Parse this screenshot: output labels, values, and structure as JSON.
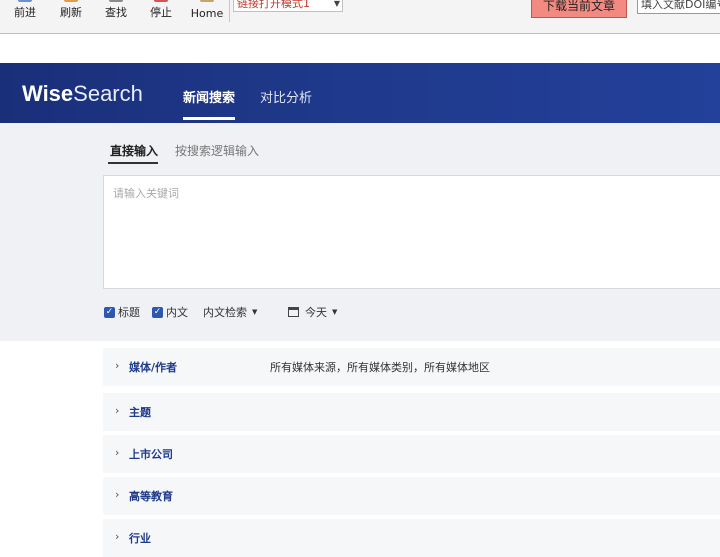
{
  "browser_toolbar": {
    "buttons": [
      "前进",
      "刷新",
      "查找",
      "停止",
      "Home"
    ],
    "mode_select": "链接打开模式1",
    "download_button": "下载当前文章",
    "doi_input_value": "填入文献DOI编号"
  },
  "header": {
    "logo_bold": "Wise",
    "logo_light": "Search",
    "nav": [
      "新闻搜索",
      "对比分析"
    ]
  },
  "search": {
    "tabs": [
      "直接输入",
      "按搜索逻辑输入"
    ],
    "placeholder": "请输入关键词",
    "options": {
      "title_label": "标题",
      "content_label": "内文",
      "scope_label": "内文检索",
      "date_label": "今天"
    }
  },
  "filters": [
    {
      "label": "媒体/作者",
      "desc": "所有媒体来源，所有媒体类别，所有媒体地区"
    },
    {
      "label": "主题",
      "desc": ""
    },
    {
      "label": "上市公司",
      "desc": ""
    },
    {
      "label": "高等教育",
      "desc": ""
    },
    {
      "label": "行业",
      "desc": ""
    }
  ],
  "colors": {
    "header_bg": "#1f3a8c",
    "download_button_bg": "#f28a82",
    "checkbox": "#2d58b0"
  }
}
